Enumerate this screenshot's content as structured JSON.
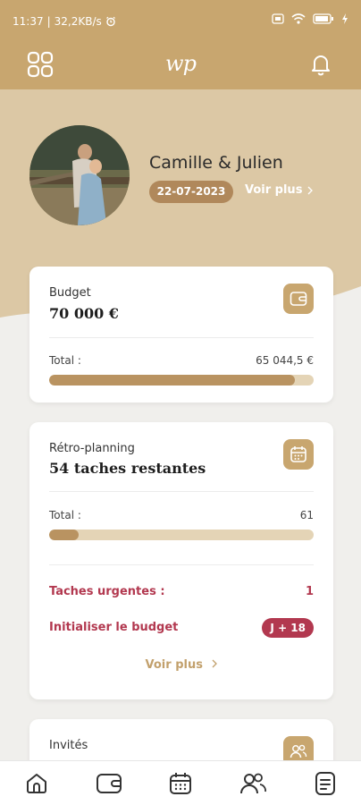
{
  "status_bar": {
    "time": "11:37",
    "speed": "32,2KB/s"
  },
  "header": {
    "logo": "wp"
  },
  "profile": {
    "names": "Camille & Julien",
    "date": "22-07-2023",
    "see_more": "Voir plus"
  },
  "budget_card": {
    "title": "Budget",
    "amount": "70 000 €",
    "total_label": "Total :",
    "total_value": "65 044,5 €",
    "progress": 0.93
  },
  "planning_card": {
    "title": "Rétro-planning",
    "tasks": "54 taches restantes",
    "total_label": "Total :",
    "total_value": "61",
    "progress": 0.11,
    "urgent_label": "Taches urgentes :",
    "urgent_count": "1",
    "init_label": "Initialiser le budget",
    "init_badge": "J + 18",
    "see_more": "Voir plus"
  },
  "guests_card": {
    "title": "Invités"
  },
  "colors": {
    "gold": "#c8a66f",
    "beige": "#dcc8a5",
    "accent": "#b2384f"
  }
}
